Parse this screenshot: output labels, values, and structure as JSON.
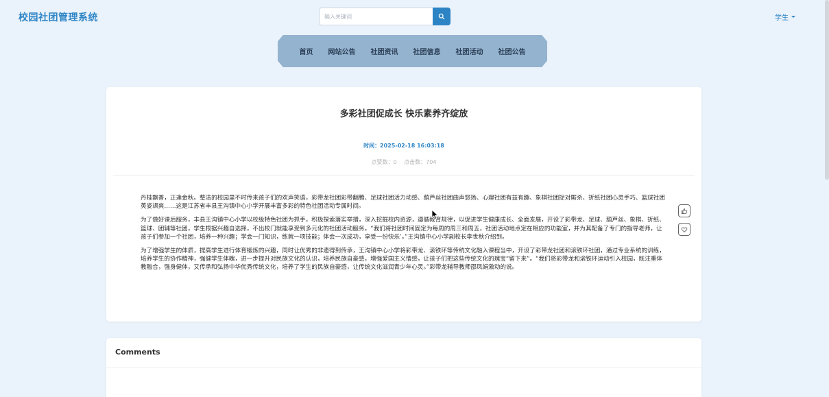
{
  "header": {
    "logo": "校园社团管理系统",
    "search_placeholder": "输入关键词",
    "user_menu_label": "学生"
  },
  "nav": {
    "items": [
      "首页",
      "网站公告",
      "社团资讯",
      "社团信息",
      "社团活动",
      "社团公告"
    ]
  },
  "article": {
    "title": "多彩社团促成长 快乐素养齐绽放",
    "time": "时间：2025-02-18 16:03:18",
    "likes": "点赞数：0",
    "clicks": "点击数：704",
    "paragraphs": [
      "丹桂飘香，正逢金秋。整洁的校园里不时传来孩子们的欢声笑语，彩带龙社团彩带翻腾、足球社团活力动感、葫芦丝社团曲声悠扬、心理社团有益有趣、象棋社团捉对厮杀、折纸社团心灵手巧、篮球社团英姿飒爽……这是江苏省丰县王沟镇中心小学开展丰富多彩的特色社团活动专属时间。",
      "为了做好课后服务，丰县王沟镇中心小学以校级特色社团为抓手，积极探索落实举措，深入挖掘校内资源，遵循教育规律，以促进学生健康成长、全面发展，开设了彩带龙、足球、葫芦丝、象棋、折纸、篮球、团辅等社团，学生根据兴趣自选择，不出校门就能享受到多元化的社团活动服务。“我们将社团时间固定为每周的周三和周五，社团活动地点定在相应的功能室，并为其配备了专门的指导老师，让孩子们参加一个社团，培养一种兴趣；学会一门知识，练就一项技能；体会一次成功，享受一份快乐’。”王沟镇中心小学副校长李世秋介绍到。",
      "为了增强学生的体质，提高学生进行体育锻炼的兴趣，同时让优秀的非遗得到传承，王沟镇中心小学将彩带龙、滚铁环等传统文化融入课程当中，开设了彩带龙社团和滚铁环社团，通过专业系统的训练，培养学生的协作精神，强健学生体魄，进一步提升对民族文化的认识，培养民族自豪感，增强爱国主义情感，让孩子们把这些传统文化的瑰宝“留下来”。“我们将彩带龙和滚铁环运动引入校园，既注重体教融合，强身健体，又传承和弘扬中华优秀传统文化，培养了学生的民族自豪感，让传统文化滋润青少年心灵。”彩带龙辅导教师邵凤娟激动的说。"
    ]
  },
  "comments": {
    "title": "Comments"
  },
  "icons": {
    "search": "search-icon",
    "like": "thumbs-up-icon",
    "favorite": "heart-icon",
    "caret": "caret-down-icon",
    "cursor": "mouse-cursor-icon"
  },
  "colors": {
    "accent": "#2f86c6",
    "nav_bg": "#94b3cf",
    "page_bg": "#eaf2fb"
  }
}
